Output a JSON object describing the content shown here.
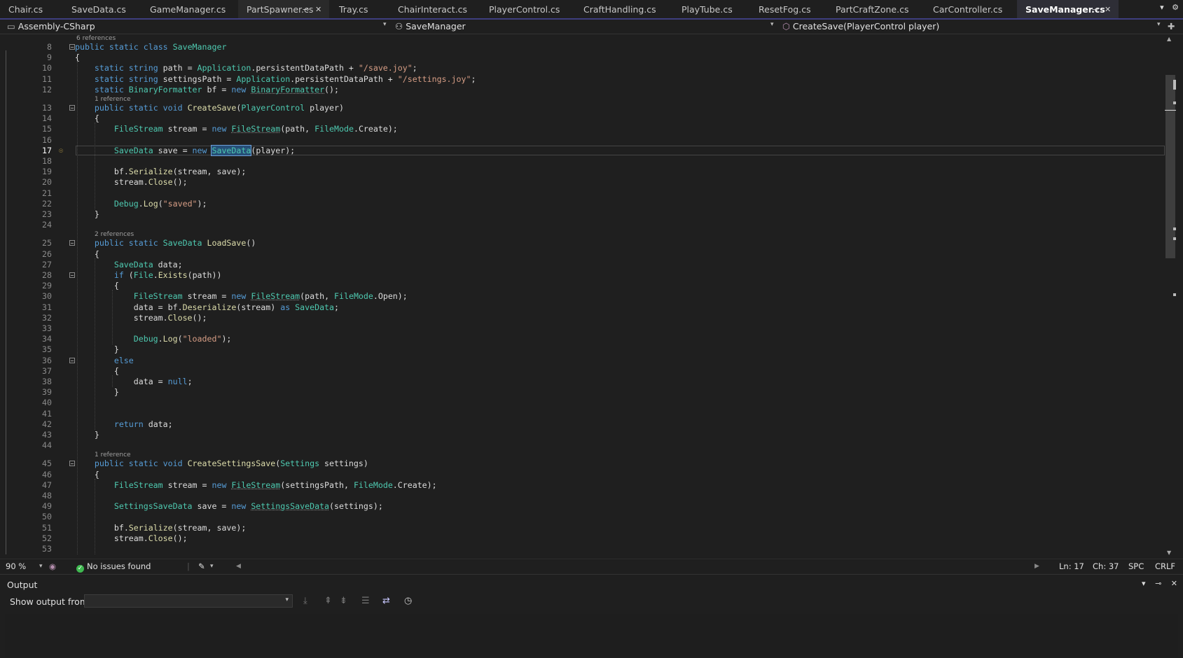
{
  "tabs": [
    {
      "label": "Chair.cs"
    },
    {
      "label": "SaveData.cs"
    },
    {
      "label": "GameManager.cs"
    },
    {
      "label": "PartSpawner.cs"
    },
    {
      "label": "Tray.cs"
    },
    {
      "label": "ChairInteract.cs"
    },
    {
      "label": "PlayerControl.cs"
    },
    {
      "label": "CraftHandling.cs"
    },
    {
      "label": "PlayTube.cs"
    },
    {
      "label": "ResetFog.cs"
    },
    {
      "label": "PartCraftZone.cs"
    },
    {
      "label": "CarController.cs"
    },
    {
      "label": "SaveManager.cs"
    }
  ],
  "icons": {
    "pin": "⊸",
    "close": "✕",
    "dropdown": "▾",
    "overflow": "▾",
    "settings": "⚙",
    "bulb": "💡",
    "check": "✓",
    "brush": "✎",
    "left": "◀",
    "right": "▶",
    "up": "▲",
    "down": "▼"
  },
  "nav": {
    "project": "Assembly-CSharp",
    "class": "SaveManager",
    "member": "CreateSave(PlayerControl player)"
  },
  "editor": {
    "lines": [
      {
        "n": "8",
        "cl": "6 references",
        "tokens": [
          [
            "kw",
            "public"
          ],
          [
            "p",
            " "
          ],
          [
            "kw",
            "static"
          ],
          [
            "p",
            " "
          ],
          [
            "kw",
            "class"
          ],
          [
            "p",
            " "
          ],
          [
            "ty",
            "SaveManager"
          ]
        ]
      },
      {
        "n": "9",
        "tokens": [
          [
            "p",
            "{"
          ]
        ]
      },
      {
        "n": "10",
        "tokens": [
          [
            "p",
            "    "
          ],
          [
            "kw",
            "static"
          ],
          [
            "p",
            " "
          ],
          [
            "kw",
            "string"
          ],
          [
            "p",
            " "
          ],
          [
            "vr",
            "path"
          ],
          [
            "p",
            " = "
          ],
          [
            "ty",
            "Application"
          ],
          [
            "p",
            "."
          ],
          [
            "vr",
            "persistentDataPath"
          ],
          [
            "p",
            " + "
          ],
          [
            "st",
            "\"/save.joy\""
          ],
          [
            "p",
            ";"
          ]
        ]
      },
      {
        "n": "11",
        "tokens": [
          [
            "p",
            "    "
          ],
          [
            "kw",
            "static"
          ],
          [
            "p",
            " "
          ],
          [
            "kw",
            "string"
          ],
          [
            "p",
            " "
          ],
          [
            "vr",
            "settingsPath"
          ],
          [
            "p",
            " = "
          ],
          [
            "ty",
            "Application"
          ],
          [
            "p",
            "."
          ],
          [
            "vr",
            "persistentDataPath"
          ],
          [
            "p",
            " + "
          ],
          [
            "st",
            "\"/settings.joy\""
          ],
          [
            "p",
            ";"
          ]
        ]
      },
      {
        "n": "12",
        "tokens": [
          [
            "p",
            "    "
          ],
          [
            "kw",
            "static"
          ],
          [
            "p",
            " "
          ],
          [
            "ty",
            "BinaryFormatter"
          ],
          [
            "p",
            " "
          ],
          [
            "vr",
            "bf"
          ],
          [
            "p",
            " = "
          ],
          [
            "kw",
            "new"
          ],
          [
            "p",
            " "
          ],
          [
            "tyu",
            "BinaryFormatter"
          ],
          [
            "p",
            "();"
          ]
        ]
      },
      {
        "n": "13",
        "cl": "1 reference",
        "tokens": [
          [
            "p",
            "    "
          ],
          [
            "kw",
            "public"
          ],
          [
            "p",
            " "
          ],
          [
            "kw",
            "static"
          ],
          [
            "p",
            " "
          ],
          [
            "kw",
            "void"
          ],
          [
            "p",
            " "
          ],
          [
            "fn",
            "CreateSave"
          ],
          [
            "p",
            "("
          ],
          [
            "ty",
            "PlayerControl"
          ],
          [
            "p",
            " "
          ],
          [
            "vr",
            "player"
          ],
          [
            "p",
            ")"
          ]
        ]
      },
      {
        "n": "14",
        "tokens": [
          [
            "p",
            "    {"
          ]
        ]
      },
      {
        "n": "15",
        "tokens": [
          [
            "p",
            "        "
          ],
          [
            "ty",
            "FileStream"
          ],
          [
            "p",
            " "
          ],
          [
            "vr",
            "stream"
          ],
          [
            "p",
            " = "
          ],
          [
            "kw",
            "new"
          ],
          [
            "p",
            " "
          ],
          [
            "tyu",
            "FileStream"
          ],
          [
            "p",
            "("
          ],
          [
            "vr",
            "path"
          ],
          [
            "p",
            ", "
          ],
          [
            "ty",
            "FileMode"
          ],
          [
            "p",
            "."
          ],
          [
            "vr",
            "Create"
          ],
          [
            "p",
            ");"
          ]
        ]
      },
      {
        "n": "16",
        "tokens": []
      },
      {
        "n": "17",
        "cur": true,
        "tokens": [
          [
            "p",
            "        "
          ],
          [
            "ty",
            "SaveData"
          ],
          [
            "p",
            " "
          ],
          [
            "vr",
            "save"
          ],
          [
            "p",
            " = "
          ],
          [
            "kw",
            "new"
          ],
          [
            "p",
            " "
          ],
          [
            "tys",
            "SaveData"
          ],
          [
            "p",
            "("
          ],
          [
            "vr",
            "player"
          ],
          [
            "p",
            ");"
          ]
        ]
      },
      {
        "n": "18",
        "tokens": []
      },
      {
        "n": "19",
        "tokens": [
          [
            "p",
            "        "
          ],
          [
            "vr",
            "bf"
          ],
          [
            "p",
            "."
          ],
          [
            "fn",
            "Serialize"
          ],
          [
            "p",
            "("
          ],
          [
            "vr",
            "stream"
          ],
          [
            "p",
            ", "
          ],
          [
            "vr",
            "save"
          ],
          [
            "p",
            ");"
          ]
        ]
      },
      {
        "n": "20",
        "tokens": [
          [
            "p",
            "        "
          ],
          [
            "vr",
            "stream"
          ],
          [
            "p",
            "."
          ],
          [
            "fn",
            "Close"
          ],
          [
            "p",
            "();"
          ]
        ]
      },
      {
        "n": "21",
        "tokens": []
      },
      {
        "n": "22",
        "tokens": [
          [
            "p",
            "        "
          ],
          [
            "ty",
            "Debug"
          ],
          [
            "p",
            "."
          ],
          [
            "fn",
            "Log"
          ],
          [
            "p",
            "("
          ],
          [
            "st",
            "\"saved\""
          ],
          [
            "p",
            ");"
          ]
        ]
      },
      {
        "n": "23",
        "tokens": [
          [
            "p",
            "    }"
          ]
        ]
      },
      {
        "n": "24",
        "tokens": []
      },
      {
        "n": "25",
        "cl": "2 references",
        "tokens": [
          [
            "p",
            "    "
          ],
          [
            "kw",
            "public"
          ],
          [
            "p",
            " "
          ],
          [
            "kw",
            "static"
          ],
          [
            "p",
            " "
          ],
          [
            "ty",
            "SaveData"
          ],
          [
            "p",
            " "
          ],
          [
            "fn",
            "LoadSave"
          ],
          [
            "p",
            "()"
          ]
        ]
      },
      {
        "n": "26",
        "tokens": [
          [
            "p",
            "    {"
          ]
        ]
      },
      {
        "n": "27",
        "tokens": [
          [
            "p",
            "        "
          ],
          [
            "ty",
            "SaveData"
          ],
          [
            "p",
            " "
          ],
          [
            "vr",
            "data"
          ],
          [
            "p",
            ";"
          ]
        ]
      },
      {
        "n": "28",
        "tokens": [
          [
            "p",
            "        "
          ],
          [
            "kw",
            "if"
          ],
          [
            "p",
            " ("
          ],
          [
            "ty",
            "File"
          ],
          [
            "p",
            "."
          ],
          [
            "fn",
            "Exists"
          ],
          [
            "p",
            "("
          ],
          [
            "vr",
            "path"
          ],
          [
            "p",
            "))"
          ]
        ]
      },
      {
        "n": "29",
        "tokens": [
          [
            "p",
            "        {"
          ]
        ]
      },
      {
        "n": "30",
        "tokens": [
          [
            "p",
            "            "
          ],
          [
            "ty",
            "FileStream"
          ],
          [
            "p",
            " "
          ],
          [
            "vr",
            "stream"
          ],
          [
            "p",
            " = "
          ],
          [
            "kw",
            "new"
          ],
          [
            "p",
            " "
          ],
          [
            "tyu",
            "FileStream"
          ],
          [
            "p",
            "("
          ],
          [
            "vr",
            "path"
          ],
          [
            "p",
            ", "
          ],
          [
            "ty",
            "FileMode"
          ],
          [
            "p",
            "."
          ],
          [
            "vr",
            "Open"
          ],
          [
            "p",
            ");"
          ]
        ]
      },
      {
        "n": "31",
        "tokens": [
          [
            "p",
            "            "
          ],
          [
            "vr",
            "data"
          ],
          [
            "p",
            " = "
          ],
          [
            "vr",
            "bf"
          ],
          [
            "p",
            "."
          ],
          [
            "fn",
            "Deserialize"
          ],
          [
            "p",
            "("
          ],
          [
            "vr",
            "stream"
          ],
          [
            "p",
            ") "
          ],
          [
            "kw",
            "as"
          ],
          [
            "p",
            " "
          ],
          [
            "ty",
            "SaveData"
          ],
          [
            "p",
            ";"
          ]
        ]
      },
      {
        "n": "32",
        "tokens": [
          [
            "p",
            "            "
          ],
          [
            "vr",
            "stream"
          ],
          [
            "p",
            "."
          ],
          [
            "fn",
            "Close"
          ],
          [
            "p",
            "();"
          ]
        ]
      },
      {
        "n": "33",
        "tokens": []
      },
      {
        "n": "34",
        "tokens": [
          [
            "p",
            "            "
          ],
          [
            "ty",
            "Debug"
          ],
          [
            "p",
            "."
          ],
          [
            "fn",
            "Log"
          ],
          [
            "p",
            "("
          ],
          [
            "st",
            "\"loaded\""
          ],
          [
            "p",
            ");"
          ]
        ]
      },
      {
        "n": "35",
        "tokens": [
          [
            "p",
            "        }"
          ]
        ]
      },
      {
        "n": "36",
        "tokens": [
          [
            "p",
            "        "
          ],
          [
            "kw",
            "else"
          ]
        ]
      },
      {
        "n": "37",
        "tokens": [
          [
            "p",
            "        {"
          ]
        ]
      },
      {
        "n": "38",
        "tokens": [
          [
            "p",
            "            "
          ],
          [
            "vr",
            "data"
          ],
          [
            "p",
            " = "
          ],
          [
            "kw",
            "null"
          ],
          [
            "p",
            ";"
          ]
        ]
      },
      {
        "n": "39",
        "tokens": [
          [
            "p",
            "        }"
          ]
        ]
      },
      {
        "n": "40",
        "tokens": []
      },
      {
        "n": "41",
        "tokens": []
      },
      {
        "n": "42",
        "tokens": [
          [
            "p",
            "        "
          ],
          [
            "kw",
            "return"
          ],
          [
            "p",
            " "
          ],
          [
            "vr",
            "data"
          ],
          [
            "p",
            ";"
          ]
        ]
      },
      {
        "n": "43",
        "tokens": [
          [
            "p",
            "    }"
          ]
        ]
      },
      {
        "n": "44",
        "tokens": []
      },
      {
        "n": "45",
        "cl": "1 reference",
        "tokens": [
          [
            "p",
            "    "
          ],
          [
            "kw",
            "public"
          ],
          [
            "p",
            " "
          ],
          [
            "kw",
            "static"
          ],
          [
            "p",
            " "
          ],
          [
            "kw",
            "void"
          ],
          [
            "p",
            " "
          ],
          [
            "fn",
            "CreateSettingsSave"
          ],
          [
            "p",
            "("
          ],
          [
            "ty",
            "Settings"
          ],
          [
            "p",
            " "
          ],
          [
            "vr",
            "settings"
          ],
          [
            "p",
            ")"
          ]
        ]
      },
      {
        "n": "46",
        "tokens": [
          [
            "p",
            "    {"
          ]
        ]
      },
      {
        "n": "47",
        "tokens": [
          [
            "p",
            "        "
          ],
          [
            "ty",
            "FileStream"
          ],
          [
            "p",
            " "
          ],
          [
            "vr",
            "stream"
          ],
          [
            "p",
            " = "
          ],
          [
            "kw",
            "new"
          ],
          [
            "p",
            " "
          ],
          [
            "tyu",
            "FileStream"
          ],
          [
            "p",
            "("
          ],
          [
            "vr",
            "settingsPath"
          ],
          [
            "p",
            ", "
          ],
          [
            "ty",
            "FileMode"
          ],
          [
            "p",
            "."
          ],
          [
            "vr",
            "Create"
          ],
          [
            "p",
            ");"
          ]
        ]
      },
      {
        "n": "48",
        "tokens": []
      },
      {
        "n": "49",
        "tokens": [
          [
            "p",
            "        "
          ],
          [
            "ty",
            "SettingsSaveData"
          ],
          [
            "p",
            " "
          ],
          [
            "vr",
            "save"
          ],
          [
            "p",
            " = "
          ],
          [
            "kw",
            "new"
          ],
          [
            "p",
            " "
          ],
          [
            "tyu",
            "SettingsSaveData"
          ],
          [
            "p",
            "("
          ],
          [
            "vr",
            "settings"
          ],
          [
            "p",
            ");"
          ]
        ]
      },
      {
        "n": "50",
        "tokens": []
      },
      {
        "n": "51",
        "tokens": [
          [
            "p",
            "        "
          ],
          [
            "vr",
            "bf"
          ],
          [
            "p",
            "."
          ],
          [
            "fn",
            "Serialize"
          ],
          [
            "p",
            "("
          ],
          [
            "vr",
            "stream"
          ],
          [
            "p",
            ", "
          ],
          [
            "vr",
            "save"
          ],
          [
            "p",
            ");"
          ]
        ]
      },
      {
        "n": "52",
        "tokens": [
          [
            "p",
            "        "
          ],
          [
            "vr",
            "stream"
          ],
          [
            "p",
            "."
          ],
          [
            "fn",
            "Close"
          ],
          [
            "p",
            "();"
          ]
        ]
      },
      {
        "n": "53",
        "tokens": []
      }
    ]
  },
  "status": {
    "zoom": "90 %",
    "issues": "No issues found",
    "ln": "Ln: 17",
    "ch": "Ch: 37",
    "spc": "SPC",
    "crlf": "CRLF"
  },
  "output": {
    "title": "Output",
    "show_from_label": "Show output from:",
    "show_from_value": ""
  }
}
